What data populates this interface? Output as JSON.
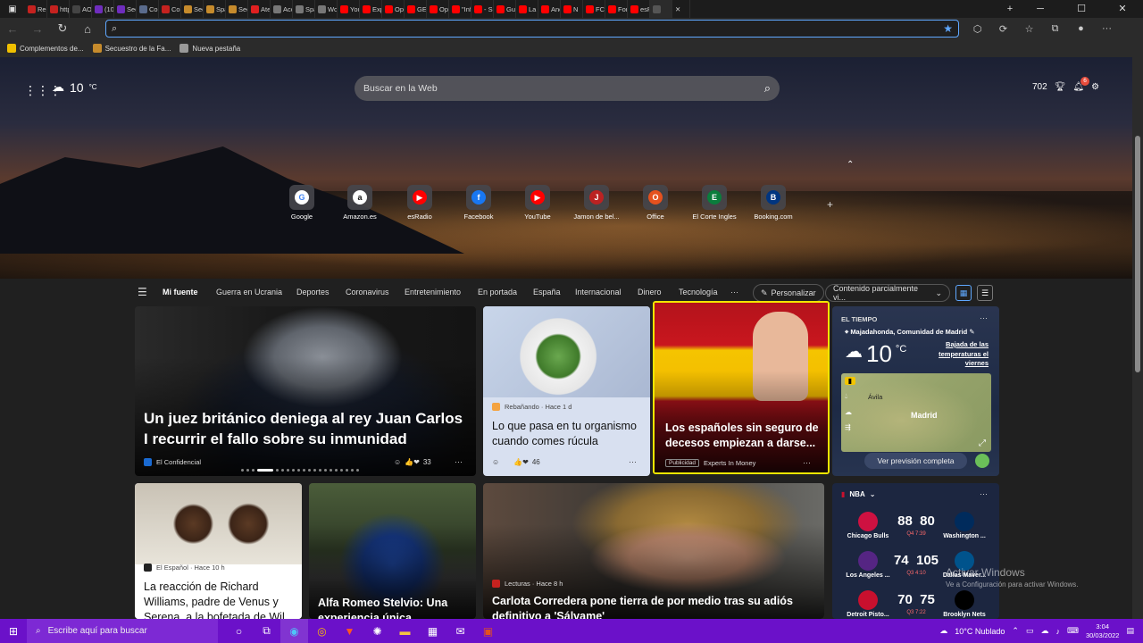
{
  "browser": {
    "tabs": [
      {
        "label": "Recib",
        "color": "#c5221f"
      },
      {
        "label": "http:",
        "color": "#c5221f"
      },
      {
        "label": "AOL",
        "color": "#444"
      },
      {
        "label": "(10 (",
        "color": "#6f2dbd"
      },
      {
        "label": "Secu",
        "color": "#6f2dbd"
      },
      {
        "label": "Con",
        "color": "#5a6b8c"
      },
      {
        "label": "Con",
        "color": "#c5221f"
      },
      {
        "label": "Secu",
        "color": "#c68b2c"
      },
      {
        "label": "Spai",
        "color": "#c68b2c"
      },
      {
        "label": "Secu",
        "color": "#c68b2c"
      },
      {
        "label": "Aten",
        "color": "#e02020"
      },
      {
        "label": "Acce",
        "color": "#777"
      },
      {
        "label": "Spai",
        "color": "#777"
      },
      {
        "label": "Wor",
        "color": "#777"
      },
      {
        "label": "YouT",
        "color": "#ff0000"
      },
      {
        "label": "Expl",
        "color": "#ff0000"
      },
      {
        "label": "Ope",
        "color": "#ff0000"
      },
      {
        "label": "GEO",
        "color": "#ff0000"
      },
      {
        "label": "Ope",
        "color": "#ff0000"
      },
      {
        "label": "\"Info",
        "color": "#ff0000"
      },
      {
        "label": "- So",
        "color": "#ff0000"
      },
      {
        "label": "Gua",
        "color": "#ff0000"
      },
      {
        "label": "La Li",
        "color": "#ff0000"
      },
      {
        "label": "Anc",
        "color": "#ff0000"
      },
      {
        "label": "N",
        "color": "#ff0000"
      },
      {
        "label": "FC E",
        "color": "#ff0000"
      },
      {
        "label": "Forc",
        "color": "#ff0000"
      },
      {
        "label": "esRa",
        "color": "#ff0000"
      },
      {
        "label": "",
        "color": "#555"
      }
    ],
    "bookmarks": [
      {
        "label": "Complementos de...",
        "color": "#f0c000"
      },
      {
        "label": "Secuestro de la Fa...",
        "color": "#c68b2c"
      },
      {
        "label": "Nueva pestaña",
        "color": "#999"
      }
    ]
  },
  "header": {
    "temp": "10",
    "temp_unit": "°C",
    "search_placeholder": "Buscar en la Web",
    "rewards_points": "702",
    "notifications": "6"
  },
  "quick_links": [
    {
      "label": "Google",
      "glyph": "G",
      "bg": "#fff",
      "fg": "#4285f4"
    },
    {
      "label": "Amazon.es",
      "glyph": "a",
      "bg": "#fff",
      "fg": "#111"
    },
    {
      "label": "esRadio",
      "glyph": "▶",
      "bg": "#ff0000",
      "fg": "#fff"
    },
    {
      "label": "Facebook",
      "glyph": "f",
      "bg": "#1877f2",
      "fg": "#fff"
    },
    {
      "label": "YouTube",
      "glyph": "▶",
      "bg": "#ff0000",
      "fg": "#fff"
    },
    {
      "label": "Jamon de bel...",
      "glyph": "J",
      "bg": "#b22",
      "fg": "#fff"
    },
    {
      "label": "Office",
      "glyph": "O",
      "bg": "#e5511e",
      "fg": "#fff"
    },
    {
      "label": "El Corte Ingles",
      "glyph": "E",
      "bg": "#0a7d3c",
      "fg": "#fff"
    },
    {
      "label": "Booking.com",
      "glyph": "B",
      "bg": "#003580",
      "fg": "#fff"
    }
  ],
  "nav": {
    "items": [
      "Mi fuente",
      "Guerra en Ucrania",
      "Deportes",
      "Coronavirus",
      "Entretenimiento",
      "En portada",
      "España",
      "Internacional",
      "Dinero",
      "Tecnología"
    ],
    "more": "···",
    "personalize": "Personalizar",
    "content_filter": "Contenido parcialmente vi..."
  },
  "cards": {
    "main": {
      "title": "Un juez británico deniega al rey Juan Carlos I recurrir el fallo sobre su inmunidad",
      "source": "El Confidencial",
      "reactions": "33"
    },
    "rucula": {
      "meta": "Rebañando · Hace 1 d",
      "title": "Lo que pasa en tu organismo cuando comes rúcula",
      "reactions": "46"
    },
    "ad": {
      "title": "Los españoles sin seguro de decesos empiezan a darse...",
      "badge": "Publicidad",
      "source": "Experts In Money"
    },
    "williams": {
      "meta": "El Español · Hace 10 h",
      "title": "La reacción de Richard Williams, padre de Venus y Serena, a la bofetada de Wil..."
    },
    "alfa": {
      "title": "Alfa Romeo Stelvio: Una experiencia única"
    },
    "carlota": {
      "meta": "Lecturas · Hace 8 h",
      "title": "Carlota Corredera pone tierra de por medio tras su adiós definitivo a 'Sálvame'"
    }
  },
  "weather_card": {
    "header": "EL TIEMPO",
    "location": "Majadahonda, Comunidad de Madrid",
    "temp": "10",
    "unit": "°C",
    "note": "Bajada de las temperaturas el viernes",
    "map_labels": [
      "Ávila",
      "Madrid"
    ],
    "button": "Ver previsión completa"
  },
  "nba_card": {
    "header": "NBA",
    "games": [
      {
        "home": "Chicago Bulls",
        "away": "Washington ...",
        "hs": "88",
        "as": "80",
        "q": "Q4 7:39",
        "hc": "#ce1141",
        "ac": "#002b5c"
      },
      {
        "home": "Los Angeles ...",
        "away": "Dallas Maver...",
        "hs": "74",
        "as": "105",
        "q": "Q3 4:10",
        "hc": "#552583",
        "ac": "#00538c"
      },
      {
        "home": "Detroit Pisto...",
        "away": "Brooklyn Nets",
        "hs": "70",
        "as": "75",
        "q": "Q3 7:22",
        "hc": "#c8102e",
        "ac": "#000"
      }
    ]
  },
  "watermark": {
    "title": "Activar Windows",
    "subtitle": "Ve a Configuración para activar Windows."
  },
  "taskbar": {
    "search": "Escribe aquí para buscar",
    "weather": "10°C  Nublado",
    "time": "3:04",
    "date": "30/03/2022"
  }
}
